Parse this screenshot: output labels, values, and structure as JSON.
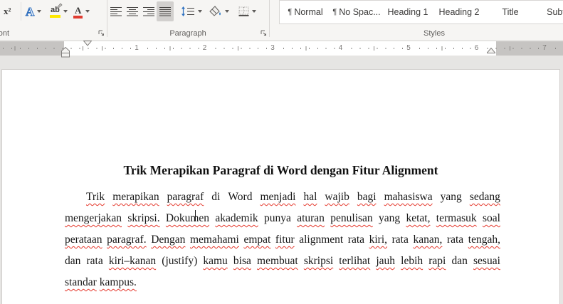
{
  "ribbon": {
    "font_group": {
      "label": "Font",
      "superscript_glyph": "x²",
      "text_effects_glyph": "A",
      "highlight_glyph": "ab",
      "font_color_glyph": "A"
    },
    "paragraph_group": {
      "label": "Paragraph"
    },
    "styles_group": {
      "label": "Styles",
      "items": [
        {
          "pilcrow": true,
          "label": "Normal"
        },
        {
          "pilcrow": true,
          "label": "No Spac..."
        },
        {
          "pilcrow": false,
          "label": "Heading 1"
        },
        {
          "pilcrow": false,
          "label": "Heading 2"
        },
        {
          "pilcrow": false,
          "label": "Title"
        },
        {
          "pilcrow": false,
          "label": "Subtitle"
        }
      ]
    }
  },
  "ruler": {
    "numbers": [
      "1",
      "2",
      "3",
      "4",
      "5",
      "6",
      "7"
    ]
  },
  "document": {
    "title": "Trik Merapikan Paragraf di Word dengan Fitur Alignment",
    "lines": [
      {
        "indent": true,
        "justify": true,
        "words": [
          {
            "t": "Trik",
            "sq": true
          },
          {
            "t": "merapikan",
            "sq": true
          },
          {
            "t": "paragraf",
            "sq": true
          },
          {
            "t": "di",
            "sq": false
          },
          {
            "t": "Word",
            "sq": false
          },
          {
            "t": "menjadi",
            "sq": true
          },
          {
            "t": "hal",
            "sq": true
          },
          {
            "t": "wajib",
            "sq": true
          },
          {
            "t": "bagi",
            "sq": true
          },
          {
            "t": "mahasiswa",
            "sq": true
          },
          {
            "t": "yang",
            "sq": false
          },
          {
            "t": "sedang",
            "sq": true
          }
        ]
      },
      {
        "indent": false,
        "justify": true,
        "words": [
          {
            "t": "mengerjakan",
            "sq": true
          },
          {
            "t": "skripsi.",
            "sq": true
          },
          {
            "t": "Dokumen",
            "sq": true
          },
          {
            "t": "akademik",
            "sq": true
          },
          {
            "t": "punya",
            "sq": false
          },
          {
            "t": "aturan",
            "sq": true
          },
          {
            "t": "penulisan",
            "sq": true
          },
          {
            "t": "yang",
            "sq": false
          },
          {
            "t": "ketat,",
            "sq": true
          },
          {
            "t": "termasuk",
            "sq": true
          },
          {
            "t": "soal",
            "sq": true
          }
        ]
      },
      {
        "indent": false,
        "justify": true,
        "words": [
          {
            "t": "perataan",
            "sq": true
          },
          {
            "t": "paragraf.",
            "sq": true
          },
          {
            "t": "Dengan",
            "sq": true
          },
          {
            "t": "memahami",
            "sq": true
          },
          {
            "t": "empat",
            "sq": true
          },
          {
            "t": "fitur",
            "sq": true
          },
          {
            "t": "alignment",
            "sq": false
          },
          {
            "t": "rata",
            "sq": false
          },
          {
            "t": "kiri,",
            "sq": true
          },
          {
            "t": "rata",
            "sq": false
          },
          {
            "t": "kanan,",
            "sq": true
          },
          {
            "t": "rata",
            "sq": false
          },
          {
            "t": "tengah,",
            "sq": true
          }
        ]
      },
      {
        "indent": false,
        "justify": true,
        "words": [
          {
            "t": "dan",
            "sq": false
          },
          {
            "t": "rata",
            "sq": false
          },
          {
            "t": "kiri–kanan",
            "sq": true
          },
          {
            "t": "(justify)",
            "sq": false
          },
          {
            "t": "kamu",
            "sq": true
          },
          {
            "t": "bisa",
            "sq": true
          },
          {
            "t": "membuat",
            "sq": true
          },
          {
            "t": "skripsi",
            "sq": true
          },
          {
            "t": "terlihat",
            "sq": true
          },
          {
            "t": "jauh",
            "sq": true
          },
          {
            "t": "lebih",
            "sq": true
          },
          {
            "t": "rapi",
            "sq": true
          },
          {
            "t": "dan",
            "sq": false
          },
          {
            "t": "sesuai",
            "sq": true
          }
        ]
      },
      {
        "indent": false,
        "justify": false,
        "words": [
          {
            "t": "standar",
            "sq": true
          },
          {
            "t": "kampus.",
            "sq": true
          }
        ]
      }
    ]
  },
  "colors": {
    "squiggle_red": "#e5362a",
    "highlight_yellow": "#ffe800",
    "font_color_red": "#e03c31",
    "text_effects_blue": "#2f6fbe",
    "selected_button_gray": "#d2d0ce"
  }
}
